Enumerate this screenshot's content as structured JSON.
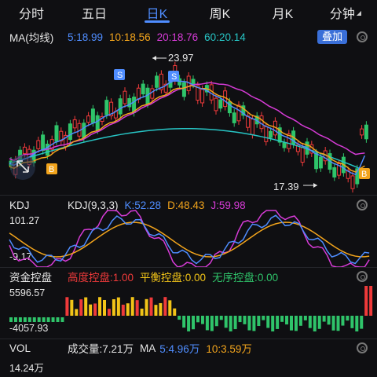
{
  "tabs": [
    "分时",
    "五日",
    "日K",
    "周K",
    "月K",
    "分钟"
  ],
  "ma": {
    "name": "MA(均线)",
    "ma5": "5:18.99",
    "ma10": "10:18.56",
    "ma20": "20:18.76",
    "ma60": "60:20.14",
    "stack_button": "叠加",
    "high_label": "23.97",
    "low_label": "17.39",
    "colors": {
      "ma5": "#4f8dff",
      "ma10": "#f2a41c",
      "ma20": "#d63bd6",
      "ma60": "#27c4c4"
    }
  },
  "kdj": {
    "name": "KDJ",
    "params": "KDJ(9,3,3)",
    "k": "K:52.28",
    "d": "D:48.43",
    "j": "J:59.98",
    "top": "101.27",
    "bottom": "-9.17"
  },
  "zj": {
    "name": "资金控盘",
    "a": "高度控盘:1.00",
    "b": "平衡控盘:0.00",
    "c": "无序控盘:0.00",
    "top": "5596.57",
    "bottom": "-4057.93"
  },
  "vol": {
    "name": "VOL",
    "total": "成交量:7.21万",
    "ma": "MA",
    "ma5": "5:4.96万",
    "ma10": "10:3.59万",
    "top": "14.24万"
  },
  "markers": [
    "S",
    "S",
    "B",
    "B"
  ]
}
